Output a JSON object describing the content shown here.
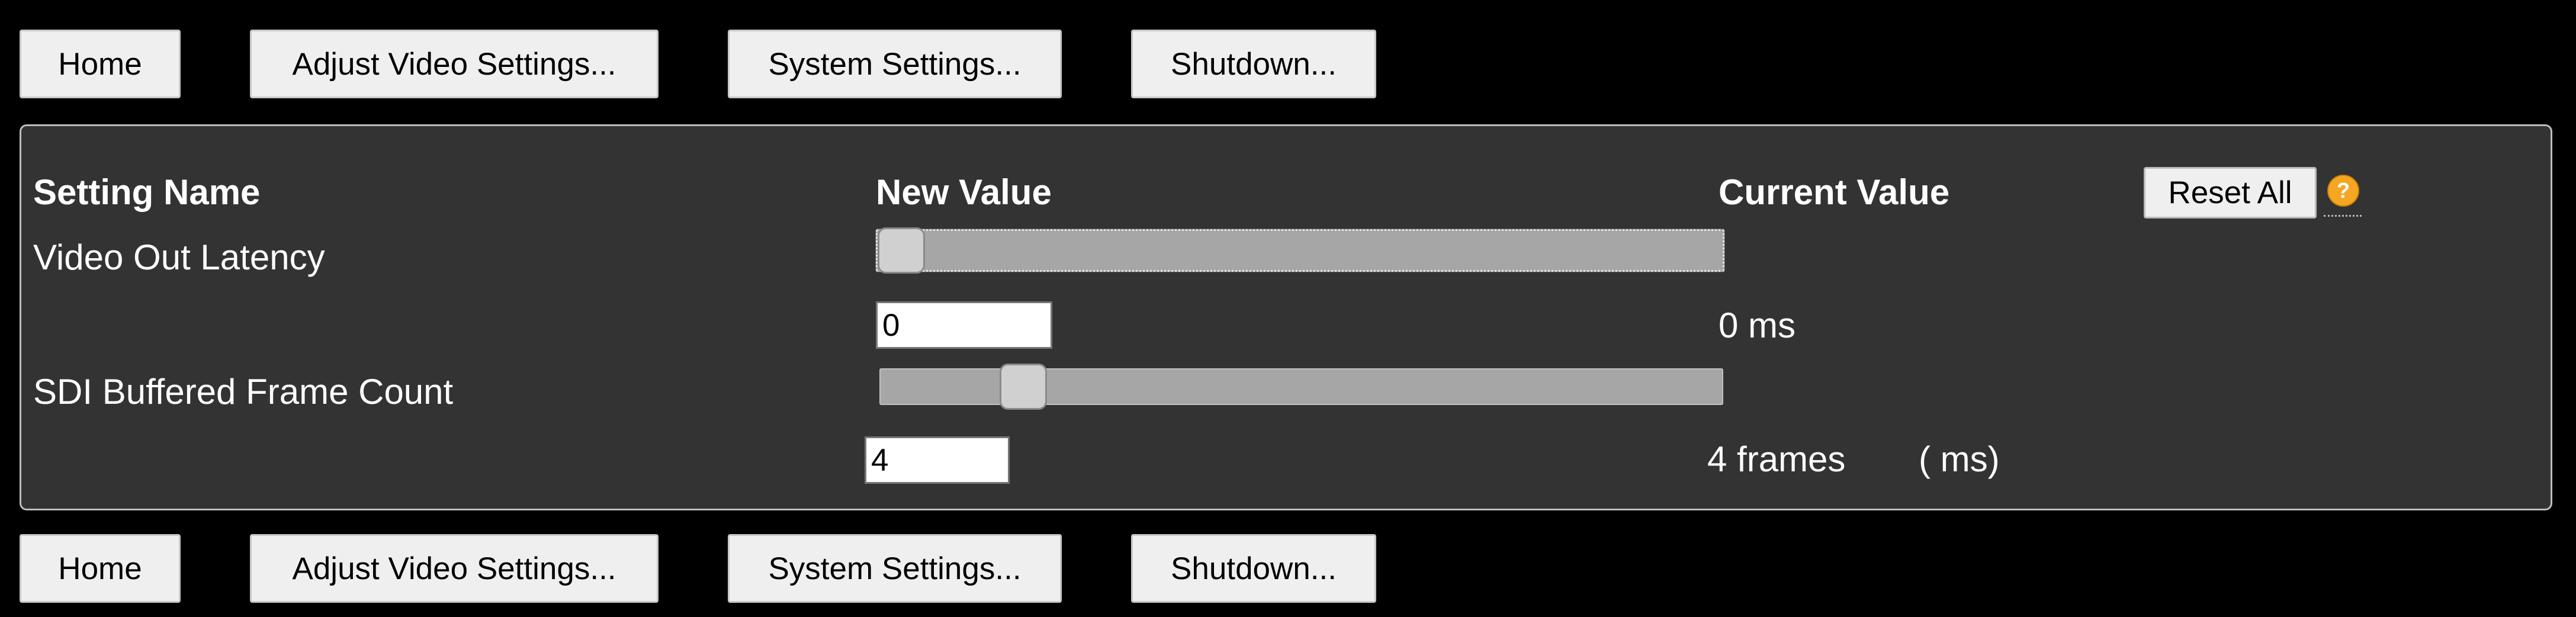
{
  "nav": {
    "home": "Home",
    "adjust_video": "Adjust Video Settings...",
    "system": "System Settings...",
    "shutdown": "Shutdown..."
  },
  "table": {
    "headers": {
      "setting_name": "Setting Name",
      "new_value": "New Value",
      "current_value": "Current Value"
    },
    "reset_all": "Reset All",
    "help_icon": "question-circle-icon",
    "rows": [
      {
        "name": "Video Out Latency",
        "slider_value": 0,
        "slider_fraction": 0.0,
        "input_value": "0",
        "current": "0 ms",
        "extra": ""
      },
      {
        "name": "SDI Buffered Frame Count",
        "slider_value": 4,
        "slider_fraction": 0.15,
        "input_value": "4",
        "current": "4 frames",
        "extra": "( ms)"
      }
    ]
  },
  "colors": {
    "background": "#000000",
    "panel": "#333333",
    "panel_border": "#bdbdbd",
    "text": "#ffffff",
    "help_icon": "#f5a623",
    "slider_track": "#a6a6a6"
  }
}
